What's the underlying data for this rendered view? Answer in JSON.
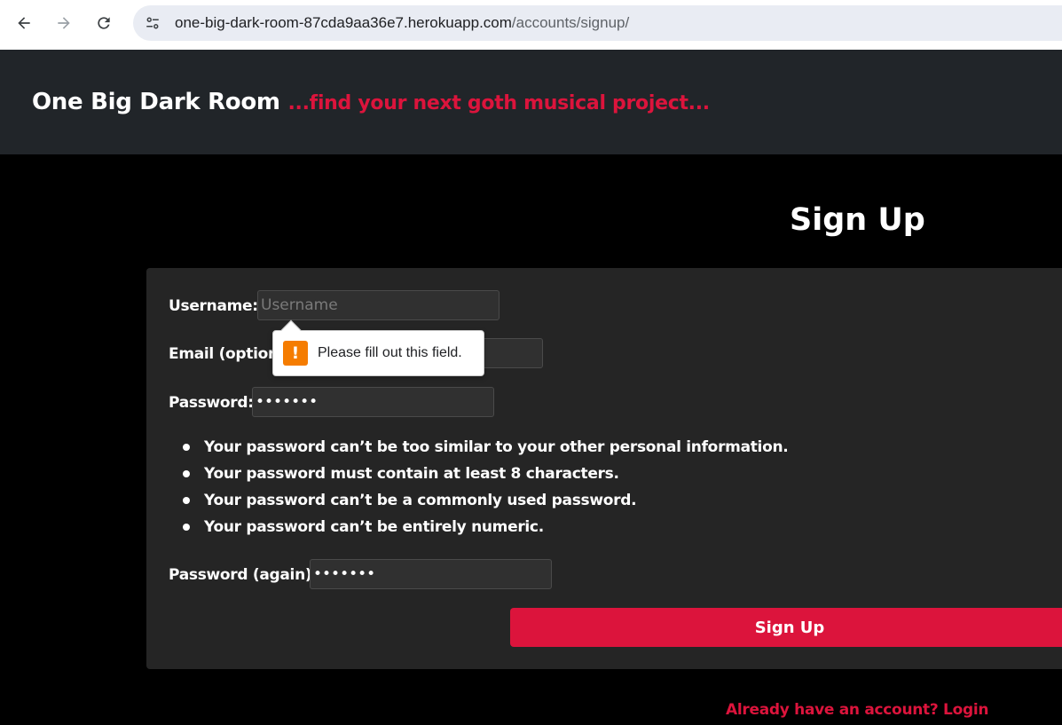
{
  "browser": {
    "url_host": "one-big-dark-room-87cda9aa36e7.herokuapp.com",
    "url_path": "/accounts/signup/"
  },
  "header": {
    "title": "One Big Dark Room",
    "tagline": "...find your next goth musical project..."
  },
  "page": {
    "title": "Sign Up"
  },
  "form": {
    "username_label": "Username:",
    "username_placeholder": "Username",
    "username_value": "",
    "email_label": "Email (optional):",
    "email_value": "",
    "password_label": "Password:",
    "password_value": "1234567",
    "password_help": [
      "Your password can’t be too similar to your other personal information.",
      "Your password must contain at least 8 characters.",
      "Your password can’t be a commonly used password.",
      "Your password can’t be entirely numeric."
    ],
    "password2_label": "Password (again):",
    "password2_value": "1234567",
    "submit_label": "Sign Up"
  },
  "validation": {
    "message": "Please fill out this field.",
    "icon": "warning-icon",
    "icon_glyph": "!"
  },
  "footer": {
    "login_link": "Already have an account? Login"
  },
  "colors": {
    "accent": "#dc143c",
    "header_bg": "#212529",
    "card_bg": "#252525",
    "page_bg": "#000000",
    "warning": "#f57c00"
  }
}
